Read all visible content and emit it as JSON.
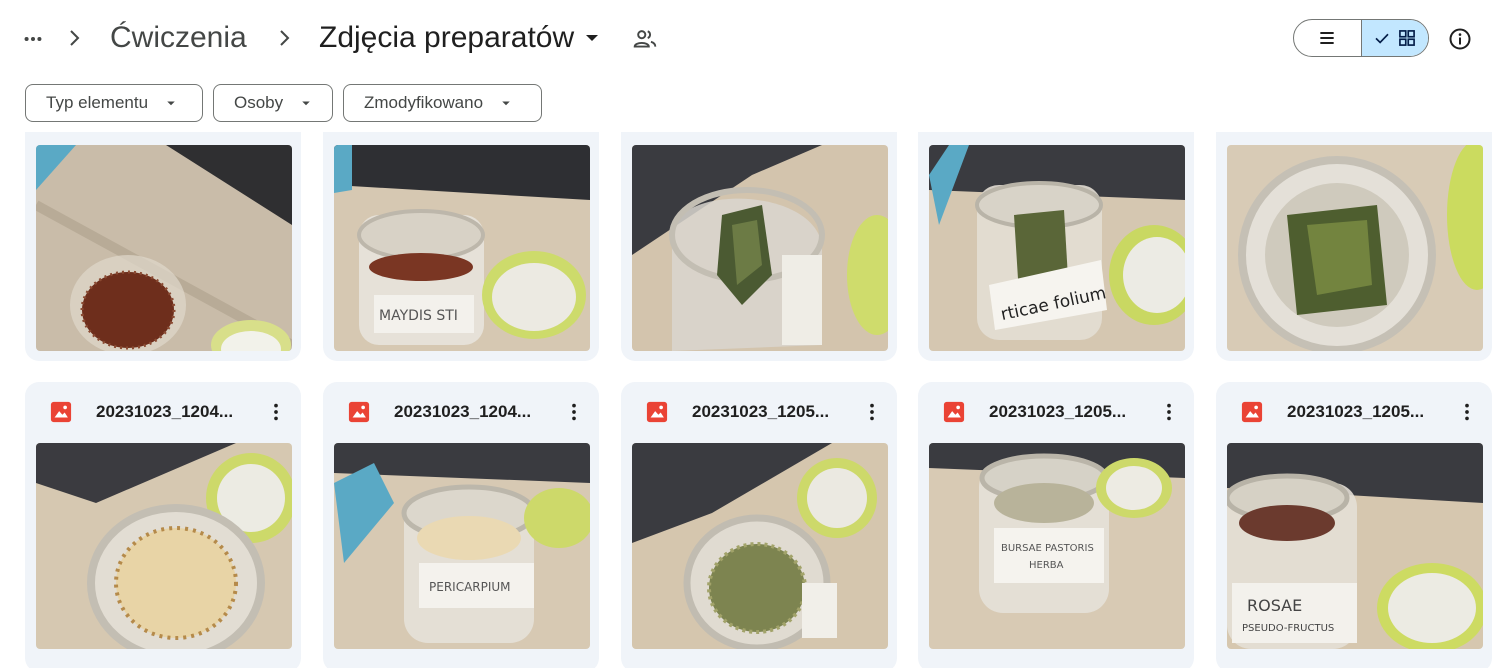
{
  "breadcrumb": {
    "parent": "Ćwiczenia",
    "current": "Zdjęcia preparatów",
    "more_icon": "more-horiz-icon",
    "separator_icon": "chevron-right-icon"
  },
  "view_toggle": {
    "list_icon": "list-view-icon",
    "grid_icon": "grid-view-icon",
    "selected": "grid"
  },
  "filters": [
    "Typ elementu",
    "Osoby",
    "Zmodyfikowano"
  ],
  "colors": {
    "accent": "#c2e7ff",
    "card_bg": "#f0f4f9",
    "image_icon": "#ea4335"
  },
  "row1_files": [
    {
      "name": "",
      "photo": "rosehip-tea-jar"
    },
    {
      "name": "",
      "photo": "maydis-jar-with-lid"
    },
    {
      "name": "",
      "photo": "leaves-jar-folium"
    },
    {
      "name": "",
      "photo": "urticae-folium-jar"
    },
    {
      "name": "",
      "photo": "dried-leaves-jar-topdown"
    }
  ],
  "row2_files": [
    {
      "name": "20231023_1204...",
      "icon": "image-file-icon"
    },
    {
      "name": "20231023_1204...",
      "icon": "image-file-icon"
    },
    {
      "name": "20231023_1205...",
      "icon": "image-file-icon"
    },
    {
      "name": "20231023_1205...",
      "icon": "image-file-icon"
    },
    {
      "name": "20231023_1205...",
      "icon": "image-file-icon"
    }
  ]
}
